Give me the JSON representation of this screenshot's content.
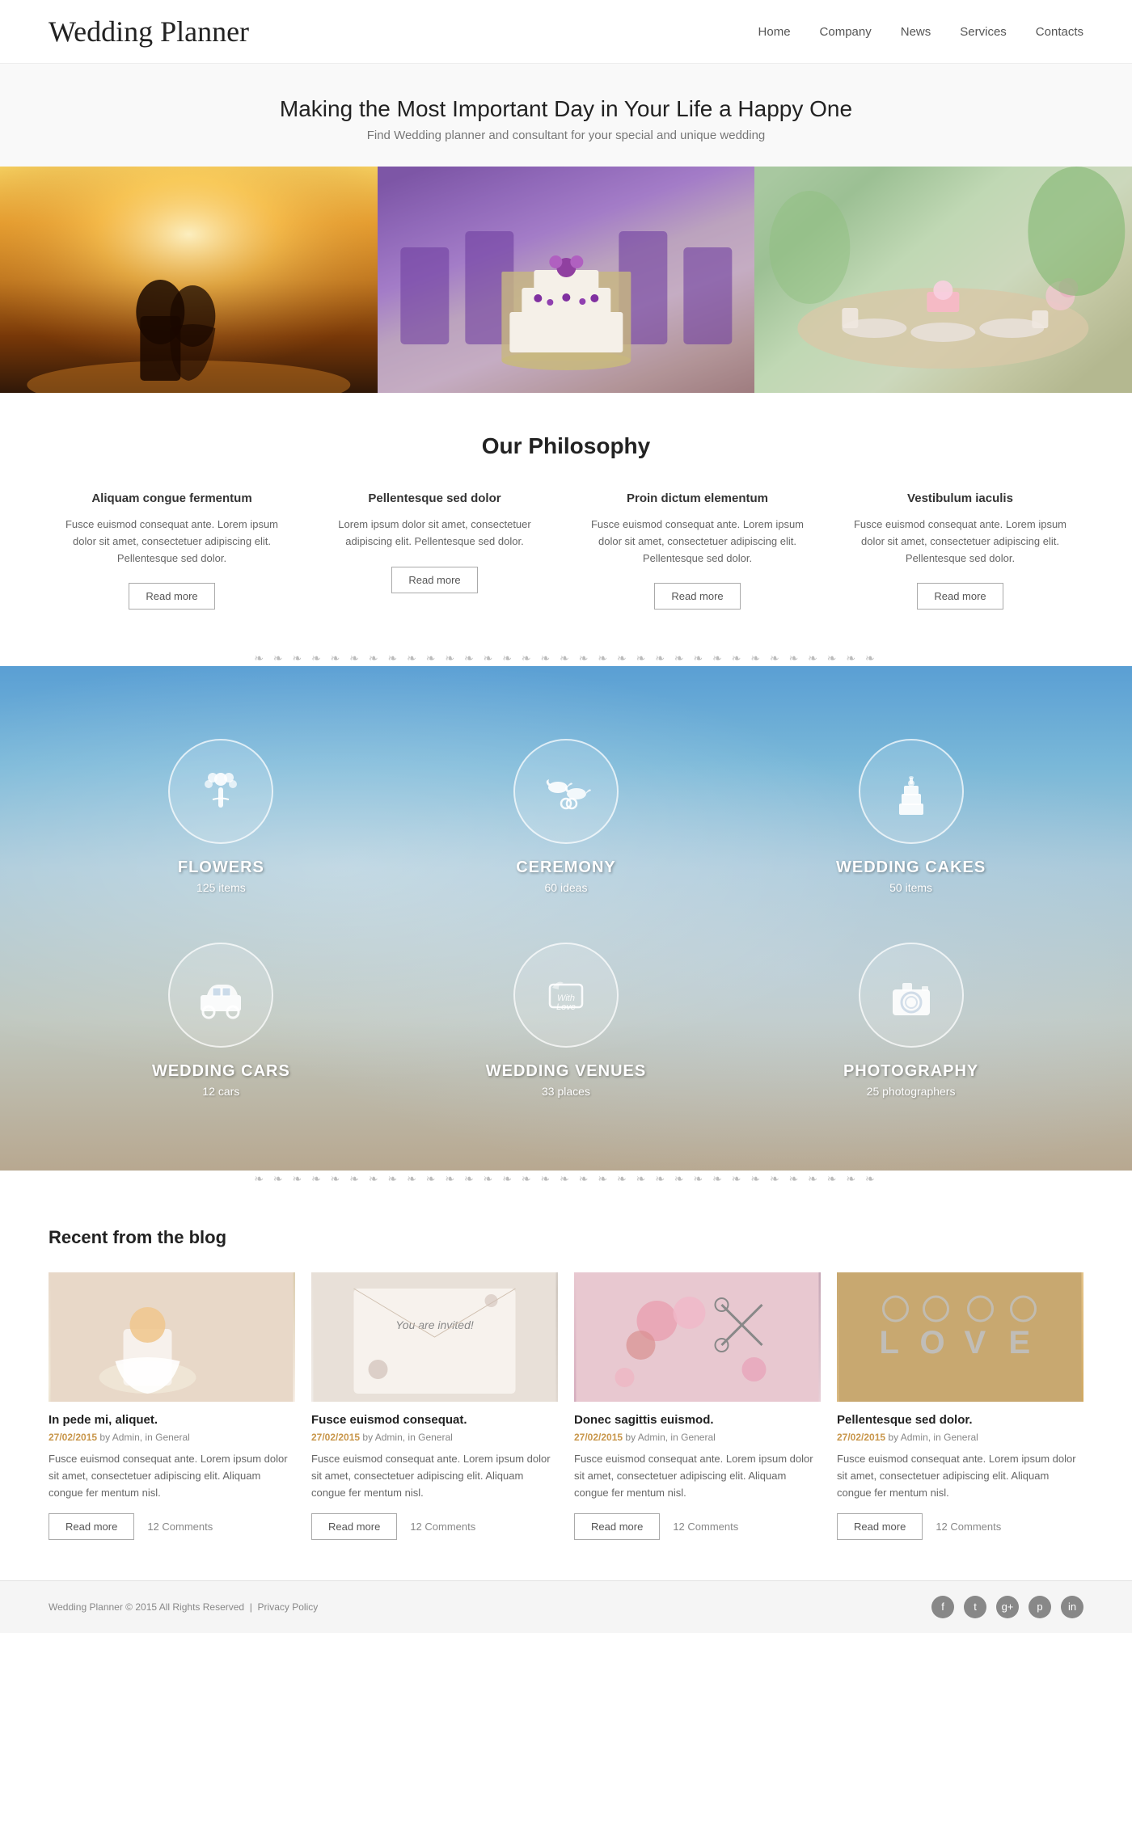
{
  "header": {
    "logo": "Wedding Planner",
    "nav": [
      {
        "label": "Home",
        "href": "#"
      },
      {
        "label": "Company",
        "href": "#"
      },
      {
        "label": "News",
        "href": "#"
      },
      {
        "label": "Services",
        "href": "#"
      },
      {
        "label": "Contacts",
        "href": "#"
      }
    ]
  },
  "hero": {
    "title": "Making the Most Important Day in Your Life a Happy One",
    "subtitle": "Find Wedding planner and consultant for your special and unique wedding"
  },
  "philosophy": {
    "heading": "Our Philosophy",
    "items": [
      {
        "title": "Aliquam congue fermentum",
        "text": "Fusce euismod consequat ante. Lorem ipsum dolor sit amet, consectetuer adipiscing elit. Pellentesque sed dolor.",
        "btn": "Read more"
      },
      {
        "title": "Pellentesque sed dolor",
        "text": "Lorem ipsum dolor sit amet, consectetuer adipiscing elit. Pellentesque sed dolor.",
        "btn": "Read more"
      },
      {
        "title": "Proin dictum elementum",
        "text": "Fusce euismod consequat ante. Lorem ipsum dolor sit amet, consectetuer adipiscing elit. Pellentesque sed dolor.",
        "btn": "Read more"
      },
      {
        "title": "Vestibulum iaculis",
        "text": "Fusce euismod consequat ante. Lorem ipsum dolor sit amet, consectetuer adipiscing elit. Pellentesque sed dolor.",
        "btn": "Read more"
      }
    ]
  },
  "categories": {
    "items": [
      {
        "icon": "💐",
        "title": "FLOWERS",
        "subtitle": "125 items"
      },
      {
        "icon": "🕊️",
        "title": "CEREMONY",
        "subtitle": "60 ideas"
      },
      {
        "icon": "🎂",
        "title": "WEDDING CAKES",
        "subtitle": "50 items"
      },
      {
        "icon": "🚗",
        "title": "WEDDING CARS",
        "subtitle": "12 cars"
      },
      {
        "icon": "💌",
        "title": "WEDDING VENUES",
        "subtitle": "33 places"
      },
      {
        "icon": "📷",
        "title": "PHOTOGRAPHY",
        "subtitle": "25 photographers"
      }
    ]
  },
  "blog": {
    "heading": "Recent from the blog",
    "items": [
      {
        "title": "In pede mi, aliquet.",
        "date": "27/02/2015",
        "meta": "by Admin, in General",
        "text": "Fusce euismod consequat ante. Lorem ipsum dolor sit amet, consectetuer adipiscing elit. Aliquam congue fer mentum nisl.",
        "btn": "Read more",
        "comments": "12 Comments"
      },
      {
        "title": "Fusce euismod consequat.",
        "date": "27/02/2015",
        "meta": "by Admin, in General",
        "text": "Fusce euismod consequat ante. Lorem ipsum dolor sit amet, consectetuer adipiscing elit. Aliquam congue fer mentum nisl.",
        "btn": "Read more",
        "comments": "12 Comments"
      },
      {
        "title": "Donec sagittis euismod.",
        "date": "27/02/2015",
        "meta": "by Admin, in General",
        "text": "Fusce euismod consequat ante. Lorem ipsum dolor sit amet, consectetuer adipiscing elit. Aliquam congue fer mentum nisl.",
        "btn": "Read more",
        "comments": "12 Comments"
      },
      {
        "title": "Pellentesque sed dolor.",
        "date": "27/02/2015",
        "meta": "by Admin, in General",
        "text": "Fusce euismod consequat ante. Lorem ipsum dolor sit amet, consectetuer adipiscing elit. Aliquam congue fer mentum nisl.",
        "btn": "Read more",
        "comments": "12 Comments"
      }
    ]
  },
  "footer": {
    "copyright": "Wedding Planner © 2015 All Rights Reserved",
    "privacy": "Privacy Policy",
    "social": [
      {
        "icon": "f",
        "name": "facebook"
      },
      {
        "icon": "t",
        "name": "twitter"
      },
      {
        "icon": "g",
        "name": "google-plus"
      },
      {
        "icon": "p",
        "name": "pinterest"
      },
      {
        "icon": "in",
        "name": "linkedin"
      }
    ]
  }
}
